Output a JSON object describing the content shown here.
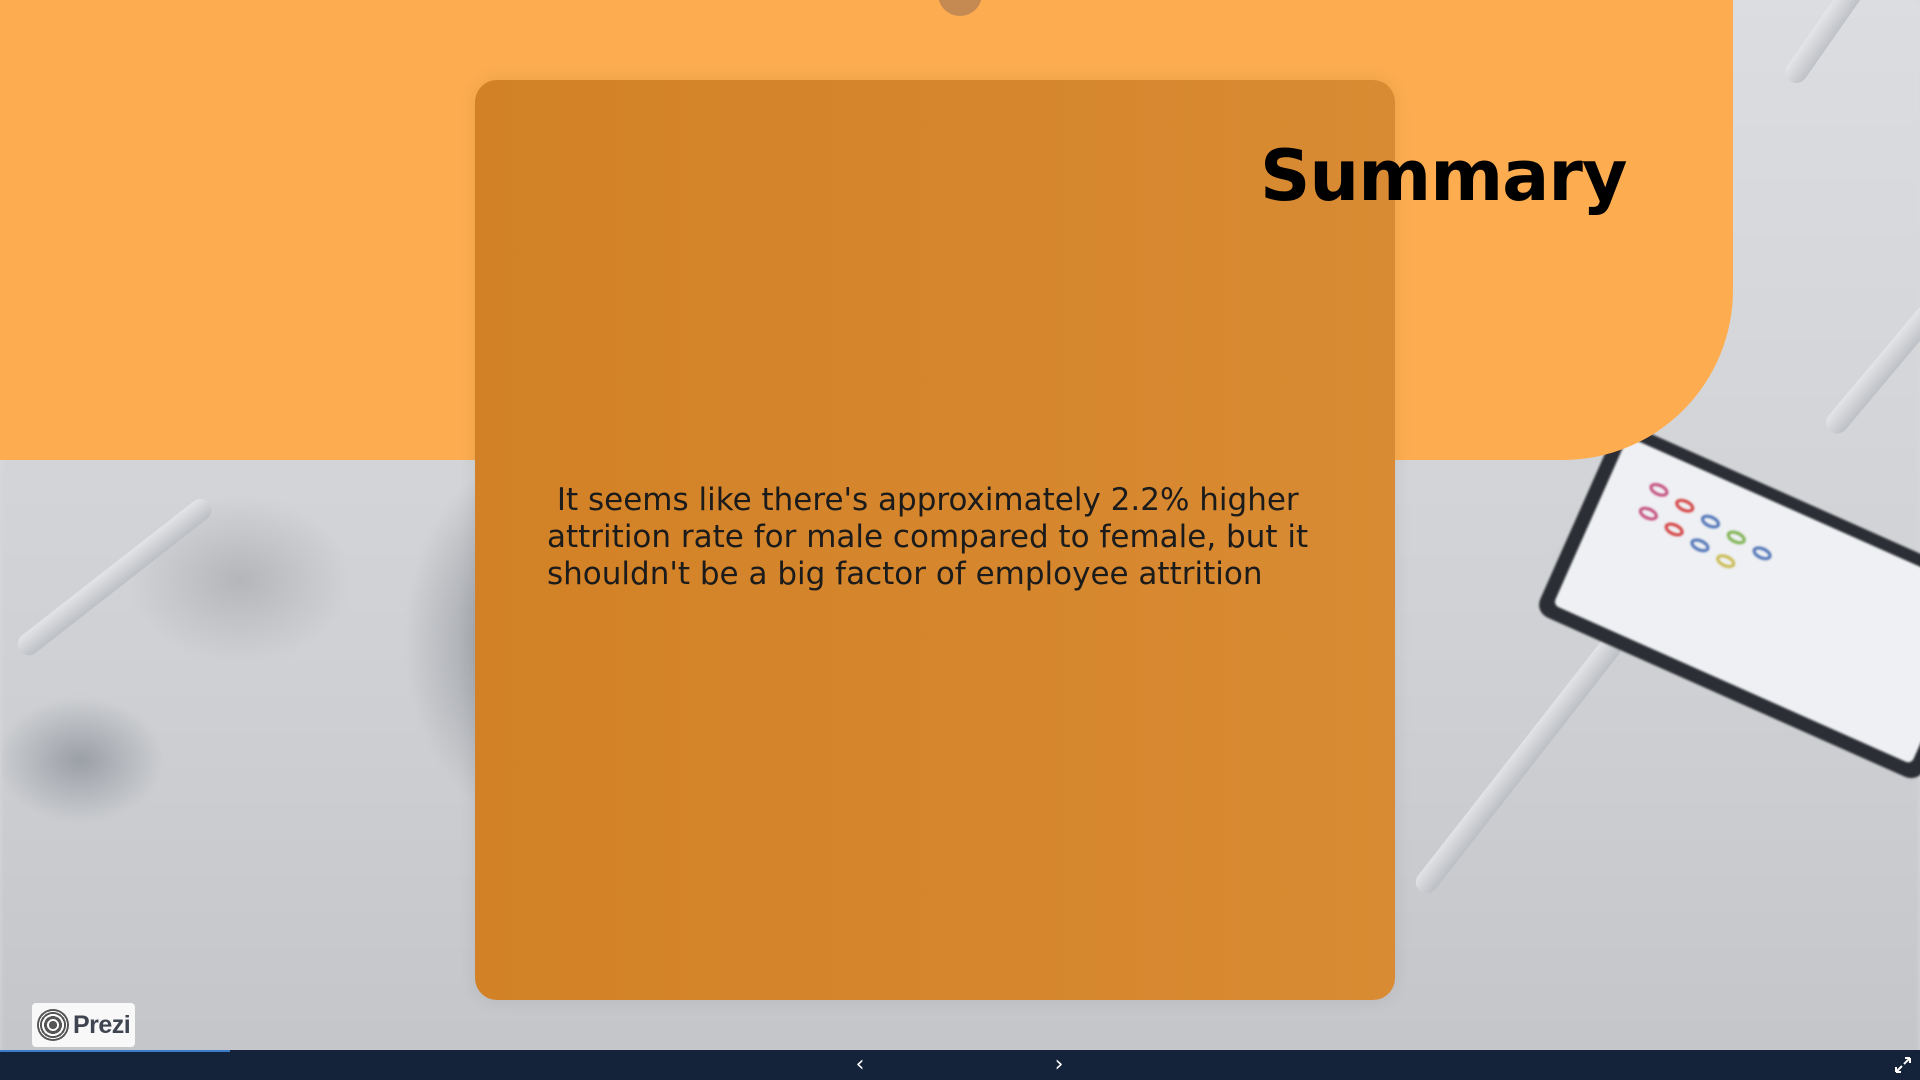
{
  "slide": {
    "title": "Summary",
    "body": " It seems like there's approximately 2.2% higher attrition rate for male compared to female, but it shouldn't be a big factor of employee attrition"
  },
  "branding": {
    "logo_text": "Prezi"
  },
  "player": {
    "prev_icon": "‹",
    "next_icon": "›",
    "progress_fraction": 0.12,
    "fullscreen_icon": "fullscreen-icon"
  },
  "colors": {
    "banner": "#fdad50",
    "card": "#d68630",
    "bar": "#14223a"
  }
}
